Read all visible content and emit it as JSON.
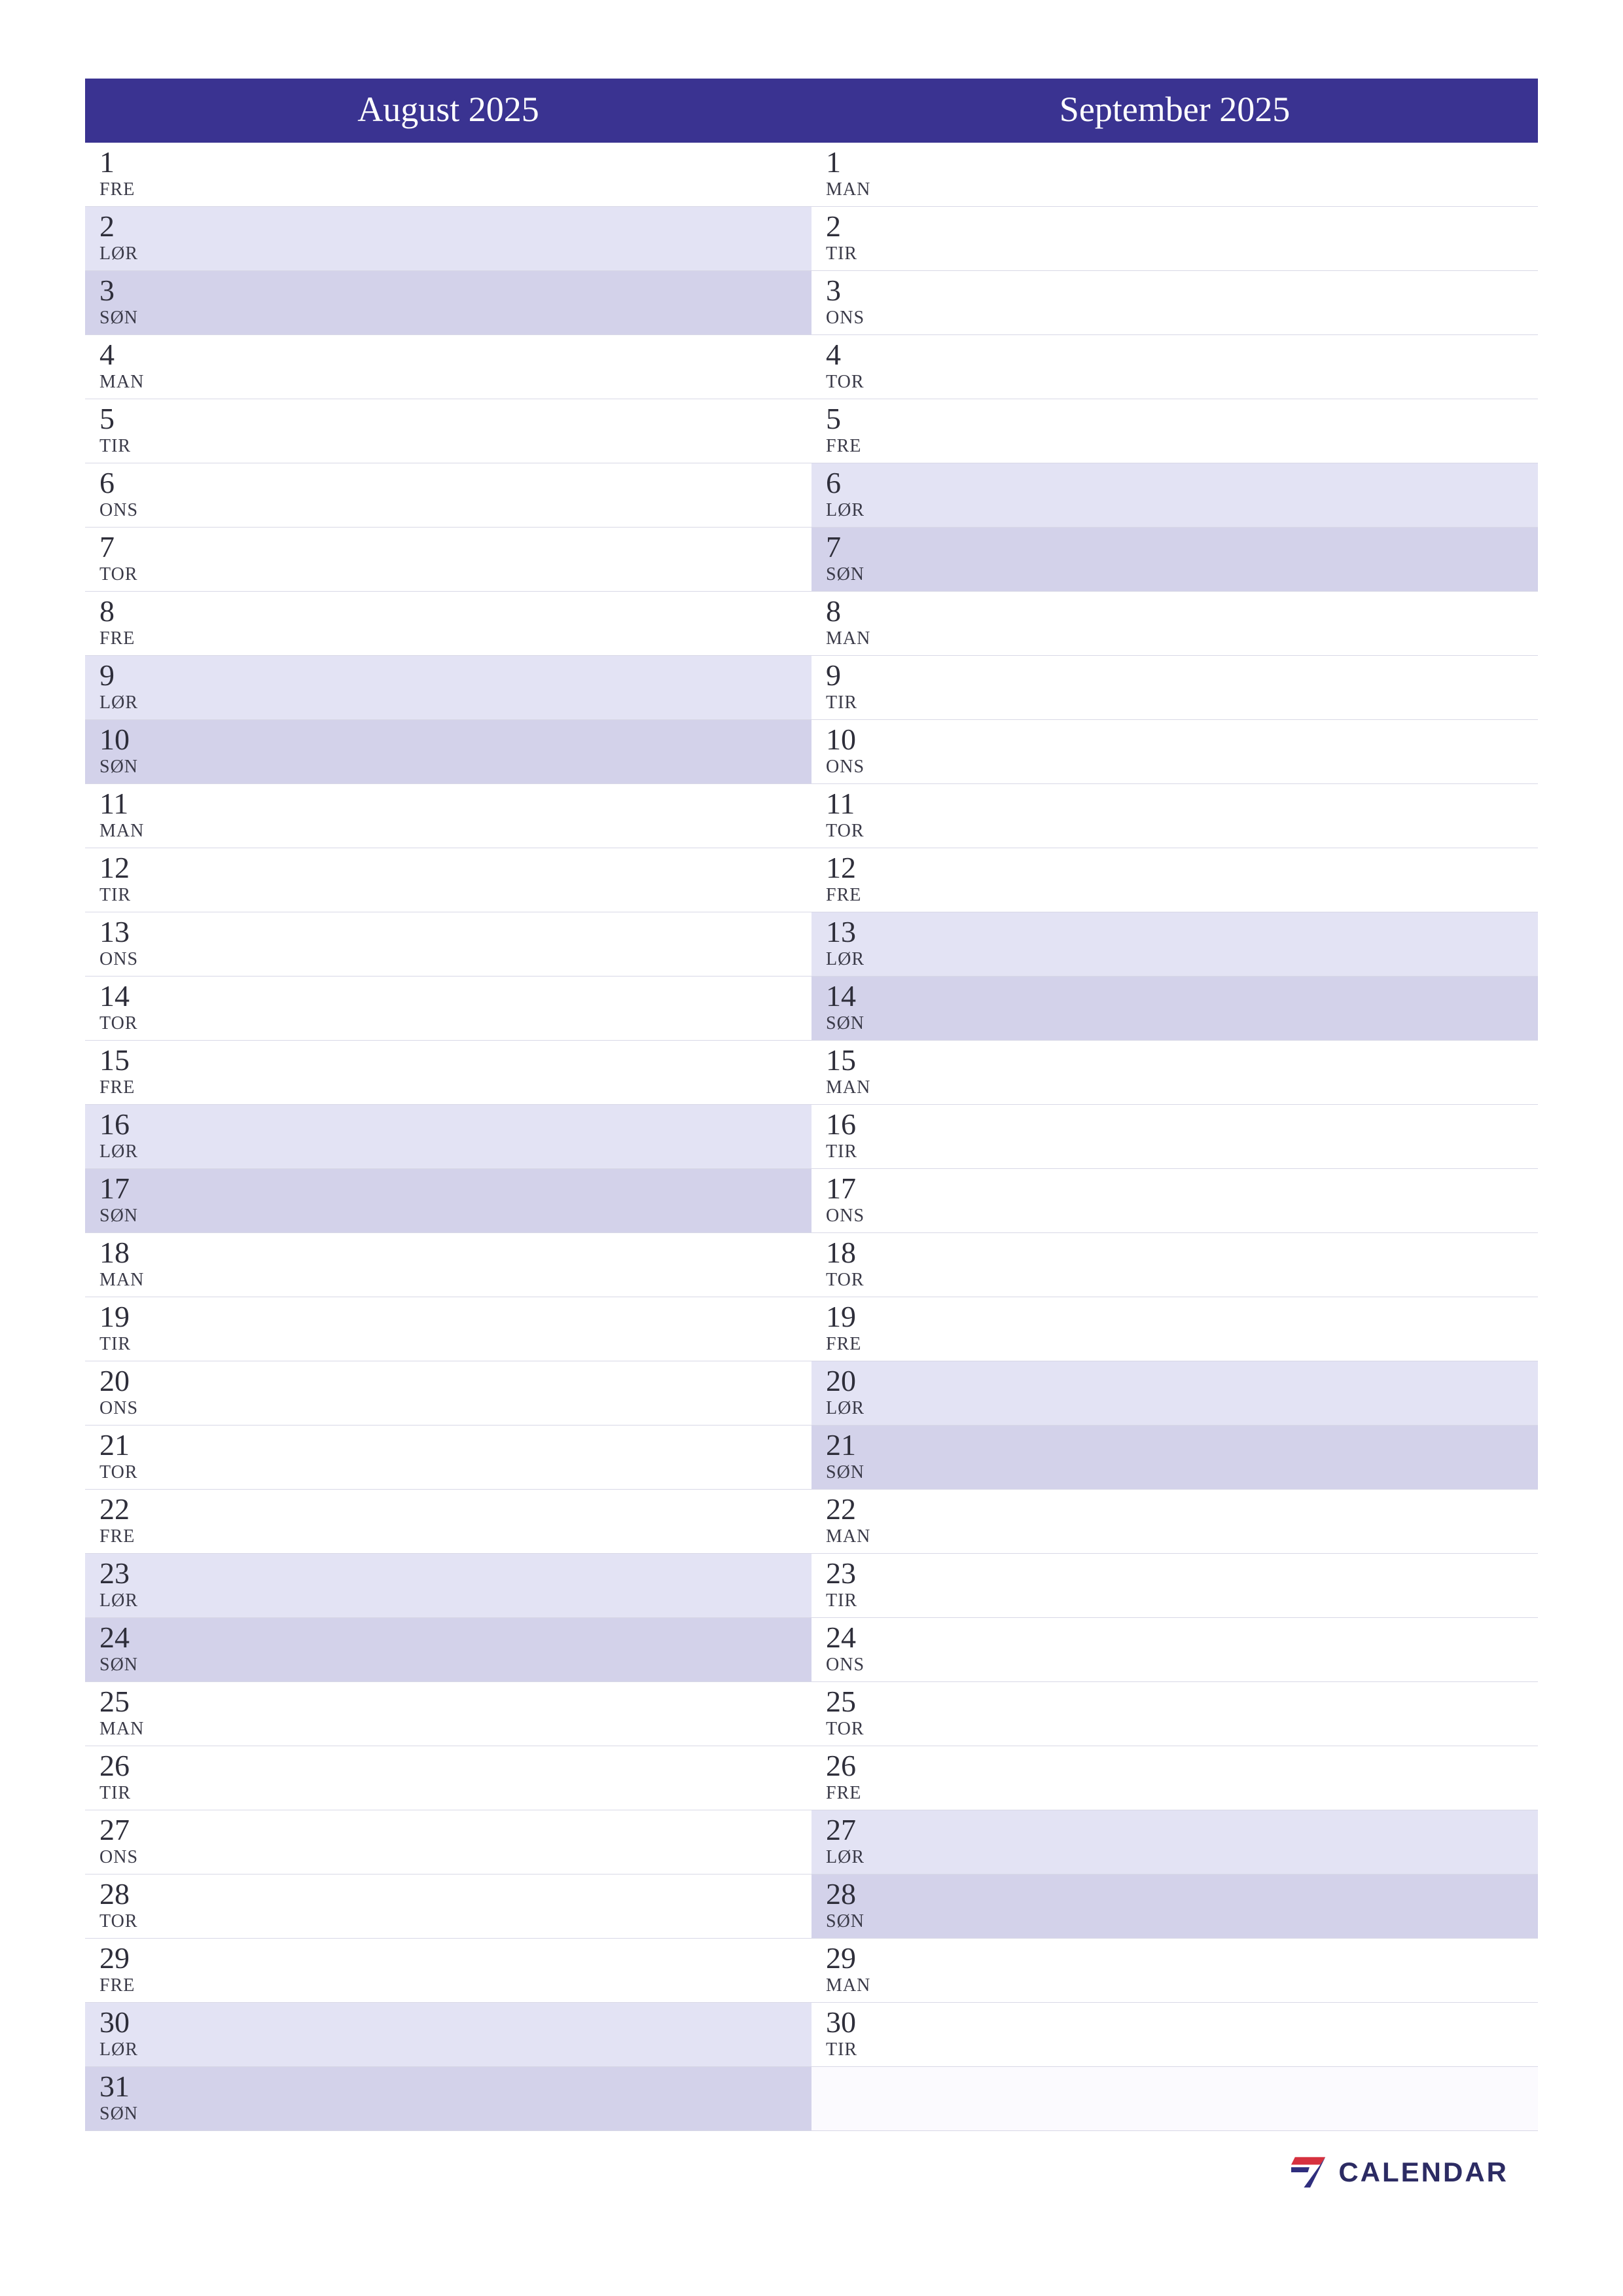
{
  "brand": {
    "text": "CALENDAR"
  },
  "day_names": {
    "mon": "MAN",
    "tue": "TIR",
    "wed": "ONS",
    "thu": "TOR",
    "fri": "FRE",
    "sat": "LØR",
    "sun": "SØN"
  },
  "colors": {
    "header_bg": "#3a3391",
    "header_fg": "#ffffff",
    "sat_bg": "#e3e3f4",
    "sun_bg": "#d3d2ea",
    "weekday_bg": "#ffffff"
  },
  "months": [
    {
      "title": "August 2025",
      "days": [
        {
          "n": "1",
          "d": "FRE",
          "t": "weekday"
        },
        {
          "n": "2",
          "d": "LØR",
          "t": "sat"
        },
        {
          "n": "3",
          "d": "SØN",
          "t": "sun"
        },
        {
          "n": "4",
          "d": "MAN",
          "t": "weekday"
        },
        {
          "n": "5",
          "d": "TIR",
          "t": "weekday"
        },
        {
          "n": "6",
          "d": "ONS",
          "t": "weekday"
        },
        {
          "n": "7",
          "d": "TOR",
          "t": "weekday"
        },
        {
          "n": "8",
          "d": "FRE",
          "t": "weekday"
        },
        {
          "n": "9",
          "d": "LØR",
          "t": "sat"
        },
        {
          "n": "10",
          "d": "SØN",
          "t": "sun"
        },
        {
          "n": "11",
          "d": "MAN",
          "t": "weekday"
        },
        {
          "n": "12",
          "d": "TIR",
          "t": "weekday"
        },
        {
          "n": "13",
          "d": "ONS",
          "t": "weekday"
        },
        {
          "n": "14",
          "d": "TOR",
          "t": "weekday"
        },
        {
          "n": "15",
          "d": "FRE",
          "t": "weekday"
        },
        {
          "n": "16",
          "d": "LØR",
          "t": "sat"
        },
        {
          "n": "17",
          "d": "SØN",
          "t": "sun"
        },
        {
          "n": "18",
          "d": "MAN",
          "t": "weekday"
        },
        {
          "n": "19",
          "d": "TIR",
          "t": "weekday"
        },
        {
          "n": "20",
          "d": "ONS",
          "t": "weekday"
        },
        {
          "n": "21",
          "d": "TOR",
          "t": "weekday"
        },
        {
          "n": "22",
          "d": "FRE",
          "t": "weekday"
        },
        {
          "n": "23",
          "d": "LØR",
          "t": "sat"
        },
        {
          "n": "24",
          "d": "SØN",
          "t": "sun"
        },
        {
          "n": "25",
          "d": "MAN",
          "t": "weekday"
        },
        {
          "n": "26",
          "d": "TIR",
          "t": "weekday"
        },
        {
          "n": "27",
          "d": "ONS",
          "t": "weekday"
        },
        {
          "n": "28",
          "d": "TOR",
          "t": "weekday"
        },
        {
          "n": "29",
          "d": "FRE",
          "t": "weekday"
        },
        {
          "n": "30",
          "d": "LØR",
          "t": "sat"
        },
        {
          "n": "31",
          "d": "SØN",
          "t": "sun"
        }
      ]
    },
    {
      "title": "September 2025",
      "days": [
        {
          "n": "1",
          "d": "MAN",
          "t": "weekday"
        },
        {
          "n": "2",
          "d": "TIR",
          "t": "weekday"
        },
        {
          "n": "3",
          "d": "ONS",
          "t": "weekday"
        },
        {
          "n": "4",
          "d": "TOR",
          "t": "weekday"
        },
        {
          "n": "5",
          "d": "FRE",
          "t": "weekday"
        },
        {
          "n": "6",
          "d": "LØR",
          "t": "sat"
        },
        {
          "n": "7",
          "d": "SØN",
          "t": "sun"
        },
        {
          "n": "8",
          "d": "MAN",
          "t": "weekday"
        },
        {
          "n": "9",
          "d": "TIR",
          "t": "weekday"
        },
        {
          "n": "10",
          "d": "ONS",
          "t": "weekday"
        },
        {
          "n": "11",
          "d": "TOR",
          "t": "weekday"
        },
        {
          "n": "12",
          "d": "FRE",
          "t": "weekday"
        },
        {
          "n": "13",
          "d": "LØR",
          "t": "sat"
        },
        {
          "n": "14",
          "d": "SØN",
          "t": "sun"
        },
        {
          "n": "15",
          "d": "MAN",
          "t": "weekday"
        },
        {
          "n": "16",
          "d": "TIR",
          "t": "weekday"
        },
        {
          "n": "17",
          "d": "ONS",
          "t": "weekday"
        },
        {
          "n": "18",
          "d": "TOR",
          "t": "weekday"
        },
        {
          "n": "19",
          "d": "FRE",
          "t": "weekday"
        },
        {
          "n": "20",
          "d": "LØR",
          "t": "sat"
        },
        {
          "n": "21",
          "d": "SØN",
          "t": "sun"
        },
        {
          "n": "22",
          "d": "MAN",
          "t": "weekday"
        },
        {
          "n": "23",
          "d": "TIR",
          "t": "weekday"
        },
        {
          "n": "24",
          "d": "ONS",
          "t": "weekday"
        },
        {
          "n": "25",
          "d": "TOR",
          "t": "weekday"
        },
        {
          "n": "26",
          "d": "FRE",
          "t": "weekday"
        },
        {
          "n": "27",
          "d": "LØR",
          "t": "sat"
        },
        {
          "n": "28",
          "d": "SØN",
          "t": "sun"
        },
        {
          "n": "29",
          "d": "MAN",
          "t": "weekday"
        },
        {
          "n": "30",
          "d": "TIR",
          "t": "weekday"
        },
        {
          "n": "",
          "d": "",
          "t": "empty"
        }
      ]
    }
  ]
}
